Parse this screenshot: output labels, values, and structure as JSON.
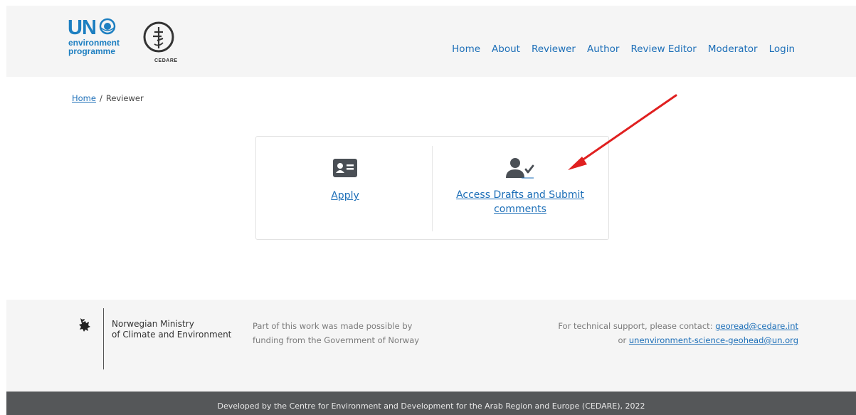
{
  "header": {
    "logo_un": "UN",
    "logo_un_line1": "environment",
    "logo_un_line2": "programme",
    "logo_cedare": "CEDARE",
    "nav": [
      "Home",
      "About",
      "Reviewer",
      "Author",
      "Review Editor",
      "Moderator",
      "Login"
    ]
  },
  "breadcrumb": {
    "home": "Home",
    "separator": "/",
    "current": "Reviewer"
  },
  "card": {
    "apply_label": "Apply",
    "access_label": "Access Drafts and Submit comments",
    "apply_icon": "id-card-icon",
    "access_icon": "user-check-icon"
  },
  "annotation": {
    "arrow_color": "#e02020"
  },
  "footer": {
    "norway_line1": "Norwegian Ministry",
    "norway_line2": "of Climate and Environment",
    "note_line1": "Part of this work was made possible by",
    "note_line2": "funding from the Government of Norway",
    "support_prefix": "For technical support, please contact:",
    "support_email1": "georead@cedare.int",
    "support_or": "or",
    "support_email2": "unenvironment-science-geohead@un.org"
  },
  "bottom_bar": {
    "text": "Developed by the Centre for Environment and Development for the Arab Region and Europe (CEDARE), 2022"
  },
  "colors": {
    "link": "#1d6fb8",
    "brand_blue": "#1d7fc1",
    "icon_gray": "#4a4f55",
    "footer_bg": "#f5f5f5",
    "bottom_bar_bg": "#555759"
  }
}
